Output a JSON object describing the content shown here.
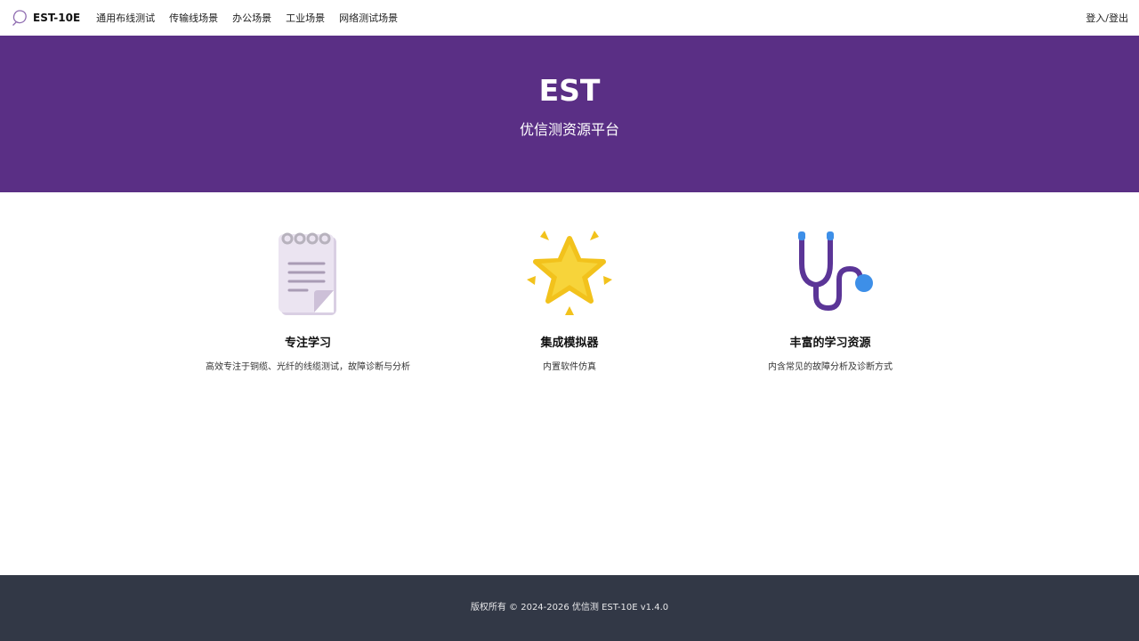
{
  "nav": {
    "brand": "EST-10E",
    "links": [
      "通用布线测试",
      "传输线场景",
      "办公场景",
      "工业场景",
      "网络测试场景"
    ],
    "login": "登入/登出"
  },
  "hero": {
    "title": "EST",
    "subtitle": "优信测资源平台",
    "background_color": "#5a2f85"
  },
  "features": [
    {
      "icon": "notepad-icon",
      "title": "专注学习",
      "desc": "高效专注于铜缆、光纤的线缆测试，故障诊断与分析"
    },
    {
      "icon": "star-icon",
      "title": "集成模拟器",
      "desc": "内置软件仿真"
    },
    {
      "icon": "stethoscope-icon",
      "title": "丰富的学习资源",
      "desc": "内含常见的故障分析及诊断方式"
    }
  ],
  "footer": {
    "text": "版权所有 © 2024-2026 优信测 EST-10E v1.4.0",
    "background_color": "#323846"
  }
}
